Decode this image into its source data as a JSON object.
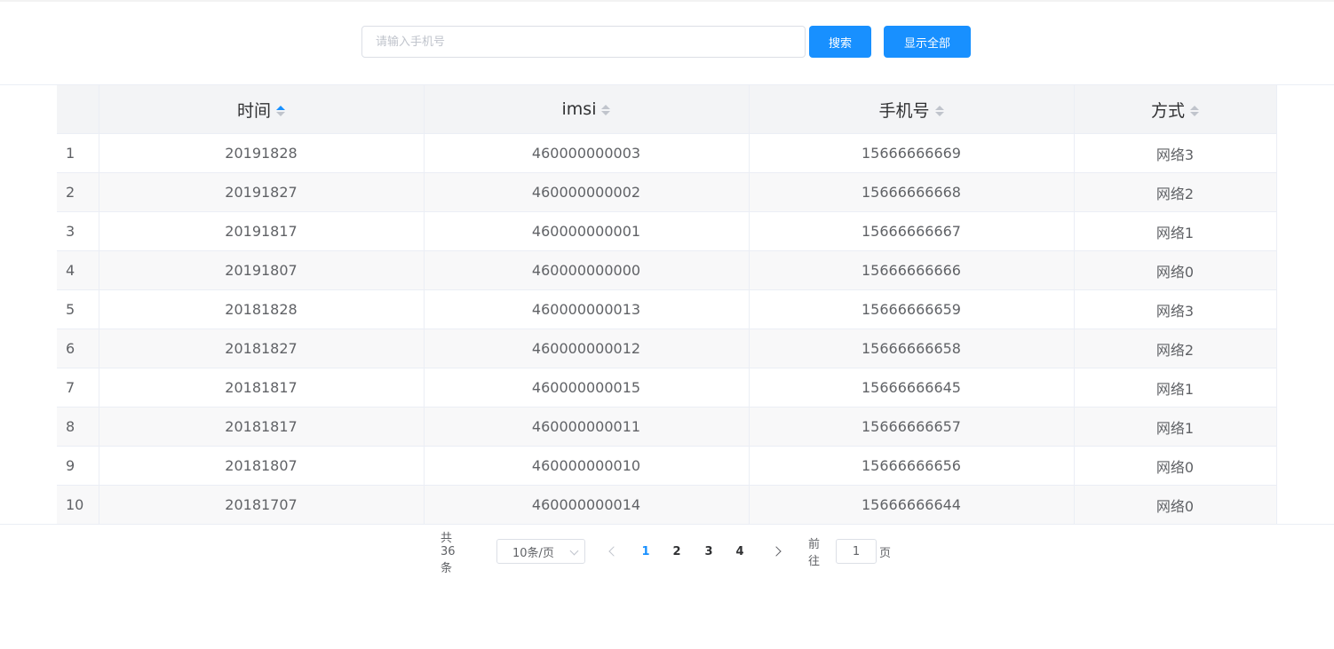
{
  "search": {
    "placeholder": "请输入手机号",
    "value": "",
    "search_label": "搜索",
    "show_all_label": "显示全部"
  },
  "table": {
    "columns": [
      {
        "label": "时间",
        "sort": "ascending"
      },
      {
        "label": "imsi",
        "sort": "none"
      },
      {
        "label": "手机号",
        "sort": "none"
      },
      {
        "label": "方式",
        "sort": "none"
      }
    ],
    "rows": [
      [
        "1",
        "20191828",
        "460000000003",
        "15666666669",
        "网络3"
      ],
      [
        "2",
        "20191827",
        "460000000002",
        "15666666668",
        "网络2"
      ],
      [
        "3",
        "20191817",
        "460000000001",
        "15666666667",
        "网络1"
      ],
      [
        "4",
        "20191807",
        "460000000000",
        "15666666666",
        "网络0"
      ],
      [
        "5",
        "20181828",
        "460000000013",
        "15666666659",
        "网络3"
      ],
      [
        "6",
        "20181827",
        "460000000012",
        "15666666658",
        "网络2"
      ],
      [
        "7",
        "20181817",
        "460000000015",
        "15666666645",
        "网络1"
      ],
      [
        "8",
        "20181817",
        "460000000011",
        "15666666657",
        "网络1"
      ],
      [
        "9",
        "20181807",
        "460000000010",
        "15666666656",
        "网络0"
      ],
      [
        "10",
        "20181707",
        "460000000014",
        "15666666644",
        "网络0"
      ]
    ]
  },
  "pagination": {
    "total_text": "共 36 条",
    "page_size": "10条/页",
    "pages": [
      "1",
      "2",
      "3",
      "4"
    ],
    "current_page": "1",
    "goto_label": "前往",
    "goto_value": "1",
    "goto_suffix": "页"
  },
  "colors": {
    "accent": "#1890ff",
    "header_bg": "#f3f4f6",
    "stripe_bg": "#f8f8f9"
  }
}
